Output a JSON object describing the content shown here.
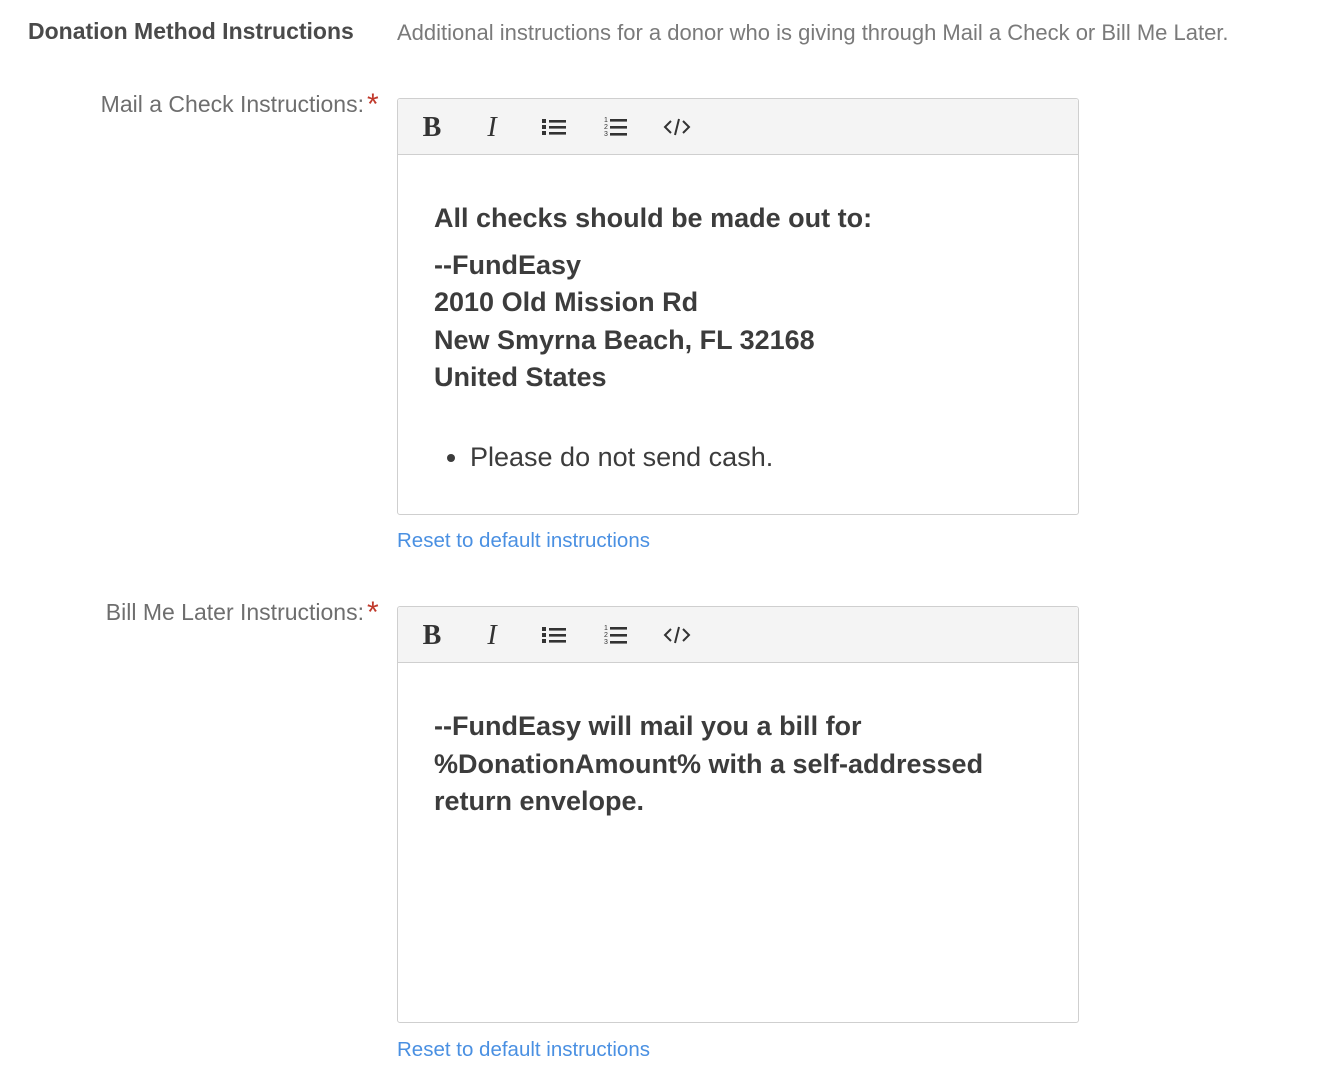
{
  "section": {
    "title": "Donation Method Instructions",
    "description": "Additional instructions for a donor who is giving through Mail a Check or Bill Me Later."
  },
  "mail_check": {
    "label": "Mail a Check Instructions:",
    "required_marker": "*",
    "heading": "All checks should be made out to:",
    "address_lines": [
      "--FundEasy",
      "2010 Old Mission Rd",
      "New Smyrna Beach, FL 32168",
      "United States"
    ],
    "bullets": [
      "Please do not send cash."
    ],
    "reset_label": "Reset to default instructions"
  },
  "bill_later": {
    "label": "Bill Me Later Instructions:",
    "required_marker": "*",
    "lines": [
      "--FundEasy will mail you a bill for",
      "%DonationAmount% with a self-addressed",
      "return envelope."
    ],
    "reset_label": "Reset to default instructions"
  },
  "toolbar": {
    "bold_label": "B",
    "italic_label": "I",
    "icons": [
      "bold-icon",
      "italic-icon",
      "bulleted-list-icon",
      "numbered-list-icon",
      "code-icon"
    ]
  },
  "colors": {
    "required": "#c0392b",
    "link": "#4a90e2",
    "toolbar_bg": "#f4f4f4",
    "border": "#cfcfcf"
  }
}
